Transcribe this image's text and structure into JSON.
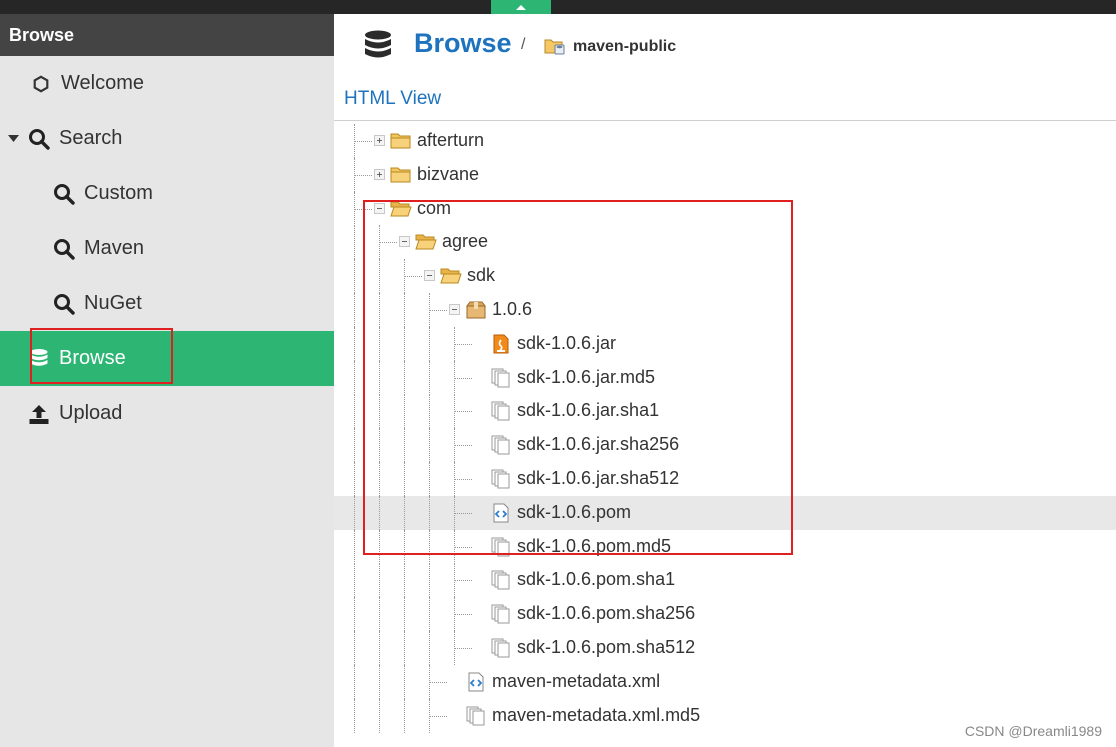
{
  "sidebar": {
    "header": "Browse",
    "items": [
      {
        "label": "Welcome",
        "icon": "hexagon-icon"
      },
      {
        "label": "Search",
        "icon": "search-icon"
      },
      {
        "label": "Custom",
        "icon": "search-icon"
      },
      {
        "label": "Maven",
        "icon": "search-icon"
      },
      {
        "label": "NuGet",
        "icon": "search-icon"
      },
      {
        "label": "Browse",
        "icon": "database-icon",
        "active": true
      },
      {
        "label": "Upload",
        "icon": "upload-icon"
      }
    ]
  },
  "main": {
    "title": "Browse",
    "breadcrumb_sep": "/",
    "repository": "maven-public",
    "html_view": "HTML View",
    "tree": [
      {
        "label": "afterturn",
        "kind": "folder",
        "toggle": "plus"
      },
      {
        "label": "bizvane",
        "kind": "folder",
        "toggle": "plus"
      },
      {
        "label": "com",
        "kind": "folder-open",
        "toggle": "minus"
      },
      {
        "label": "agree",
        "kind": "folder-open",
        "toggle": "minus"
      },
      {
        "label": "sdk",
        "kind": "folder-open",
        "toggle": "minus"
      },
      {
        "label": "1.0.6",
        "kind": "package",
        "toggle": "minus"
      },
      {
        "label": "sdk-1.0.6.jar",
        "kind": "jar"
      },
      {
        "label": "sdk-1.0.6.jar.md5",
        "kind": "file"
      },
      {
        "label": "sdk-1.0.6.jar.sha1",
        "kind": "file"
      },
      {
        "label": "sdk-1.0.6.jar.sha256",
        "kind": "file"
      },
      {
        "label": "sdk-1.0.6.jar.sha512",
        "kind": "file"
      },
      {
        "label": "sdk-1.0.6.pom",
        "kind": "xml",
        "highlighted": true
      },
      {
        "label": "sdk-1.0.6.pom.md5",
        "kind": "file"
      },
      {
        "label": "sdk-1.0.6.pom.sha1",
        "kind": "file"
      },
      {
        "label": "sdk-1.0.6.pom.sha256",
        "kind": "file"
      },
      {
        "label": "sdk-1.0.6.pom.sha512",
        "kind": "file"
      },
      {
        "label": "maven-metadata.xml",
        "kind": "xml"
      },
      {
        "label": "maven-metadata.xml.md5",
        "kind": "file"
      }
    ]
  },
  "watermark": "CSDN @Dreamli1989",
  "colors": {
    "accent": "#2db573",
    "link": "#1e73be",
    "header": "#444444",
    "annotation": "#e02020"
  }
}
